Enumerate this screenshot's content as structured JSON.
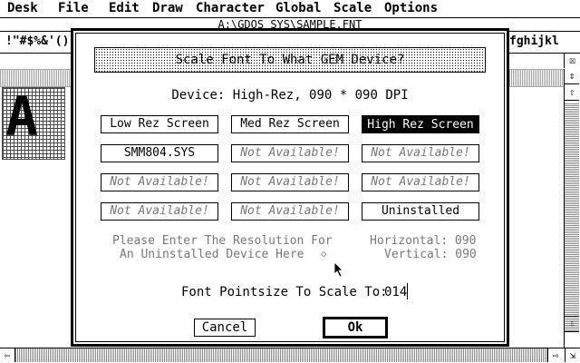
{
  "menubar": {
    "items": [
      "Desk",
      "File",
      "Edit",
      "Draw",
      "Character",
      "Global",
      "Scale",
      "Options"
    ]
  },
  "background_window": {
    "title": "A:\\GDOS_SYS\\SAMPLE.FNT",
    "charstrip_left": "!\"#$%&'()",
    "charstrip_right": "fghijkl",
    "glyph": "A"
  },
  "dialog": {
    "title": "Scale Font To What GEM Device?",
    "device_line": "Device: High-Rez, 090 * 090 DPI",
    "buttons": [
      {
        "label": "Low Rez Screen",
        "state": "normal"
      },
      {
        "label": "Med Rez Screen",
        "state": "normal"
      },
      {
        "label": "High Rez Screen",
        "state": "selected"
      },
      {
        "label": "SMM804.SYS",
        "state": "normal"
      },
      {
        "label": "Not Available!",
        "state": "disabled"
      },
      {
        "label": "Not Available!",
        "state": "disabled"
      },
      {
        "label": "Not Available!",
        "state": "disabled"
      },
      {
        "label": "Not Available!",
        "state": "disabled"
      },
      {
        "label": "Not Available!",
        "state": "disabled"
      },
      {
        "label": "Not Available!",
        "state": "disabled"
      },
      {
        "label": "Not Available!",
        "state": "disabled"
      },
      {
        "label": "Uninstalled",
        "state": "normal"
      }
    ],
    "resolution_prompt_line1": "Please Enter The Resolution For",
    "resolution_prompt_line2": "An Uninstalled Device Here",
    "horizontal_label": "Horizontal: 090",
    "vertical_label": "Vertical: 090",
    "pointsize_label": "Font Pointsize To Scale To:",
    "pointsize_value": "014",
    "cancel_label": "Cancel",
    "ok_label": "Ok"
  },
  "icons": {
    "close": "x",
    "fullbox": "diamond",
    "arrow_up": "up-arrow",
    "arrow_down": "down-arrow",
    "arrow_left": "left-arrow",
    "arrow_right": "right-arrow",
    "sizer": "resize"
  }
}
